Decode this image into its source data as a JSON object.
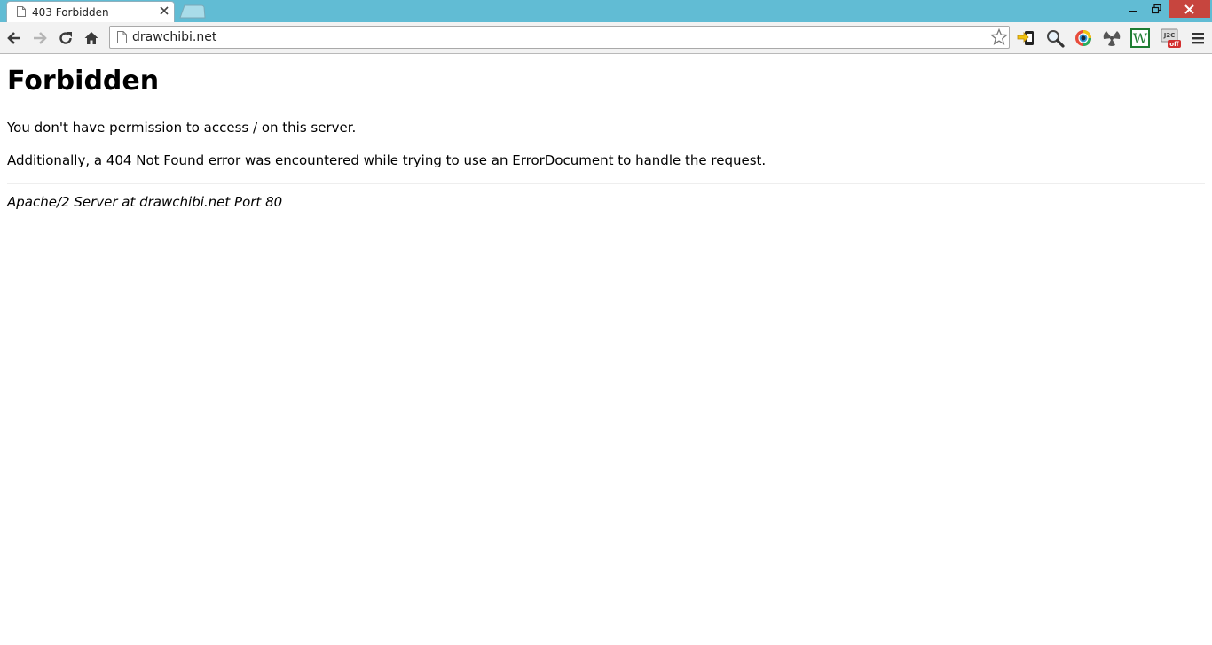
{
  "browser": {
    "tab": {
      "title": "403 Forbidden",
      "favicon": "page-icon"
    },
    "omnibox": {
      "url": "drawchibi.net"
    },
    "toolbar_icons": [
      "back-arrow-icon",
      "forward-arrow-icon",
      "reload-icon",
      "home-icon"
    ],
    "extension_icons": [
      "yellow-arrow-phone-icon",
      "magnifier-icon",
      "colorful-ring-icon",
      "radiation-icon",
      "w-icon",
      "j2c-off-icon",
      "hamburger-menu-icon"
    ],
    "ext_labels": {
      "w": "W",
      "j2c": "J2C",
      "off": "off"
    },
    "colors": {
      "titlebar": "#61bcd4",
      "close_button": "#c7453e"
    }
  },
  "page": {
    "heading": "Forbidden",
    "message": "You don't have permission to access / on this server.",
    "additional": "Additionally, a 404 Not Found error was encountered while trying to use an ErrorDocument to handle the request.",
    "address": "Apache/2 Server at drawchibi.net Port 80"
  }
}
